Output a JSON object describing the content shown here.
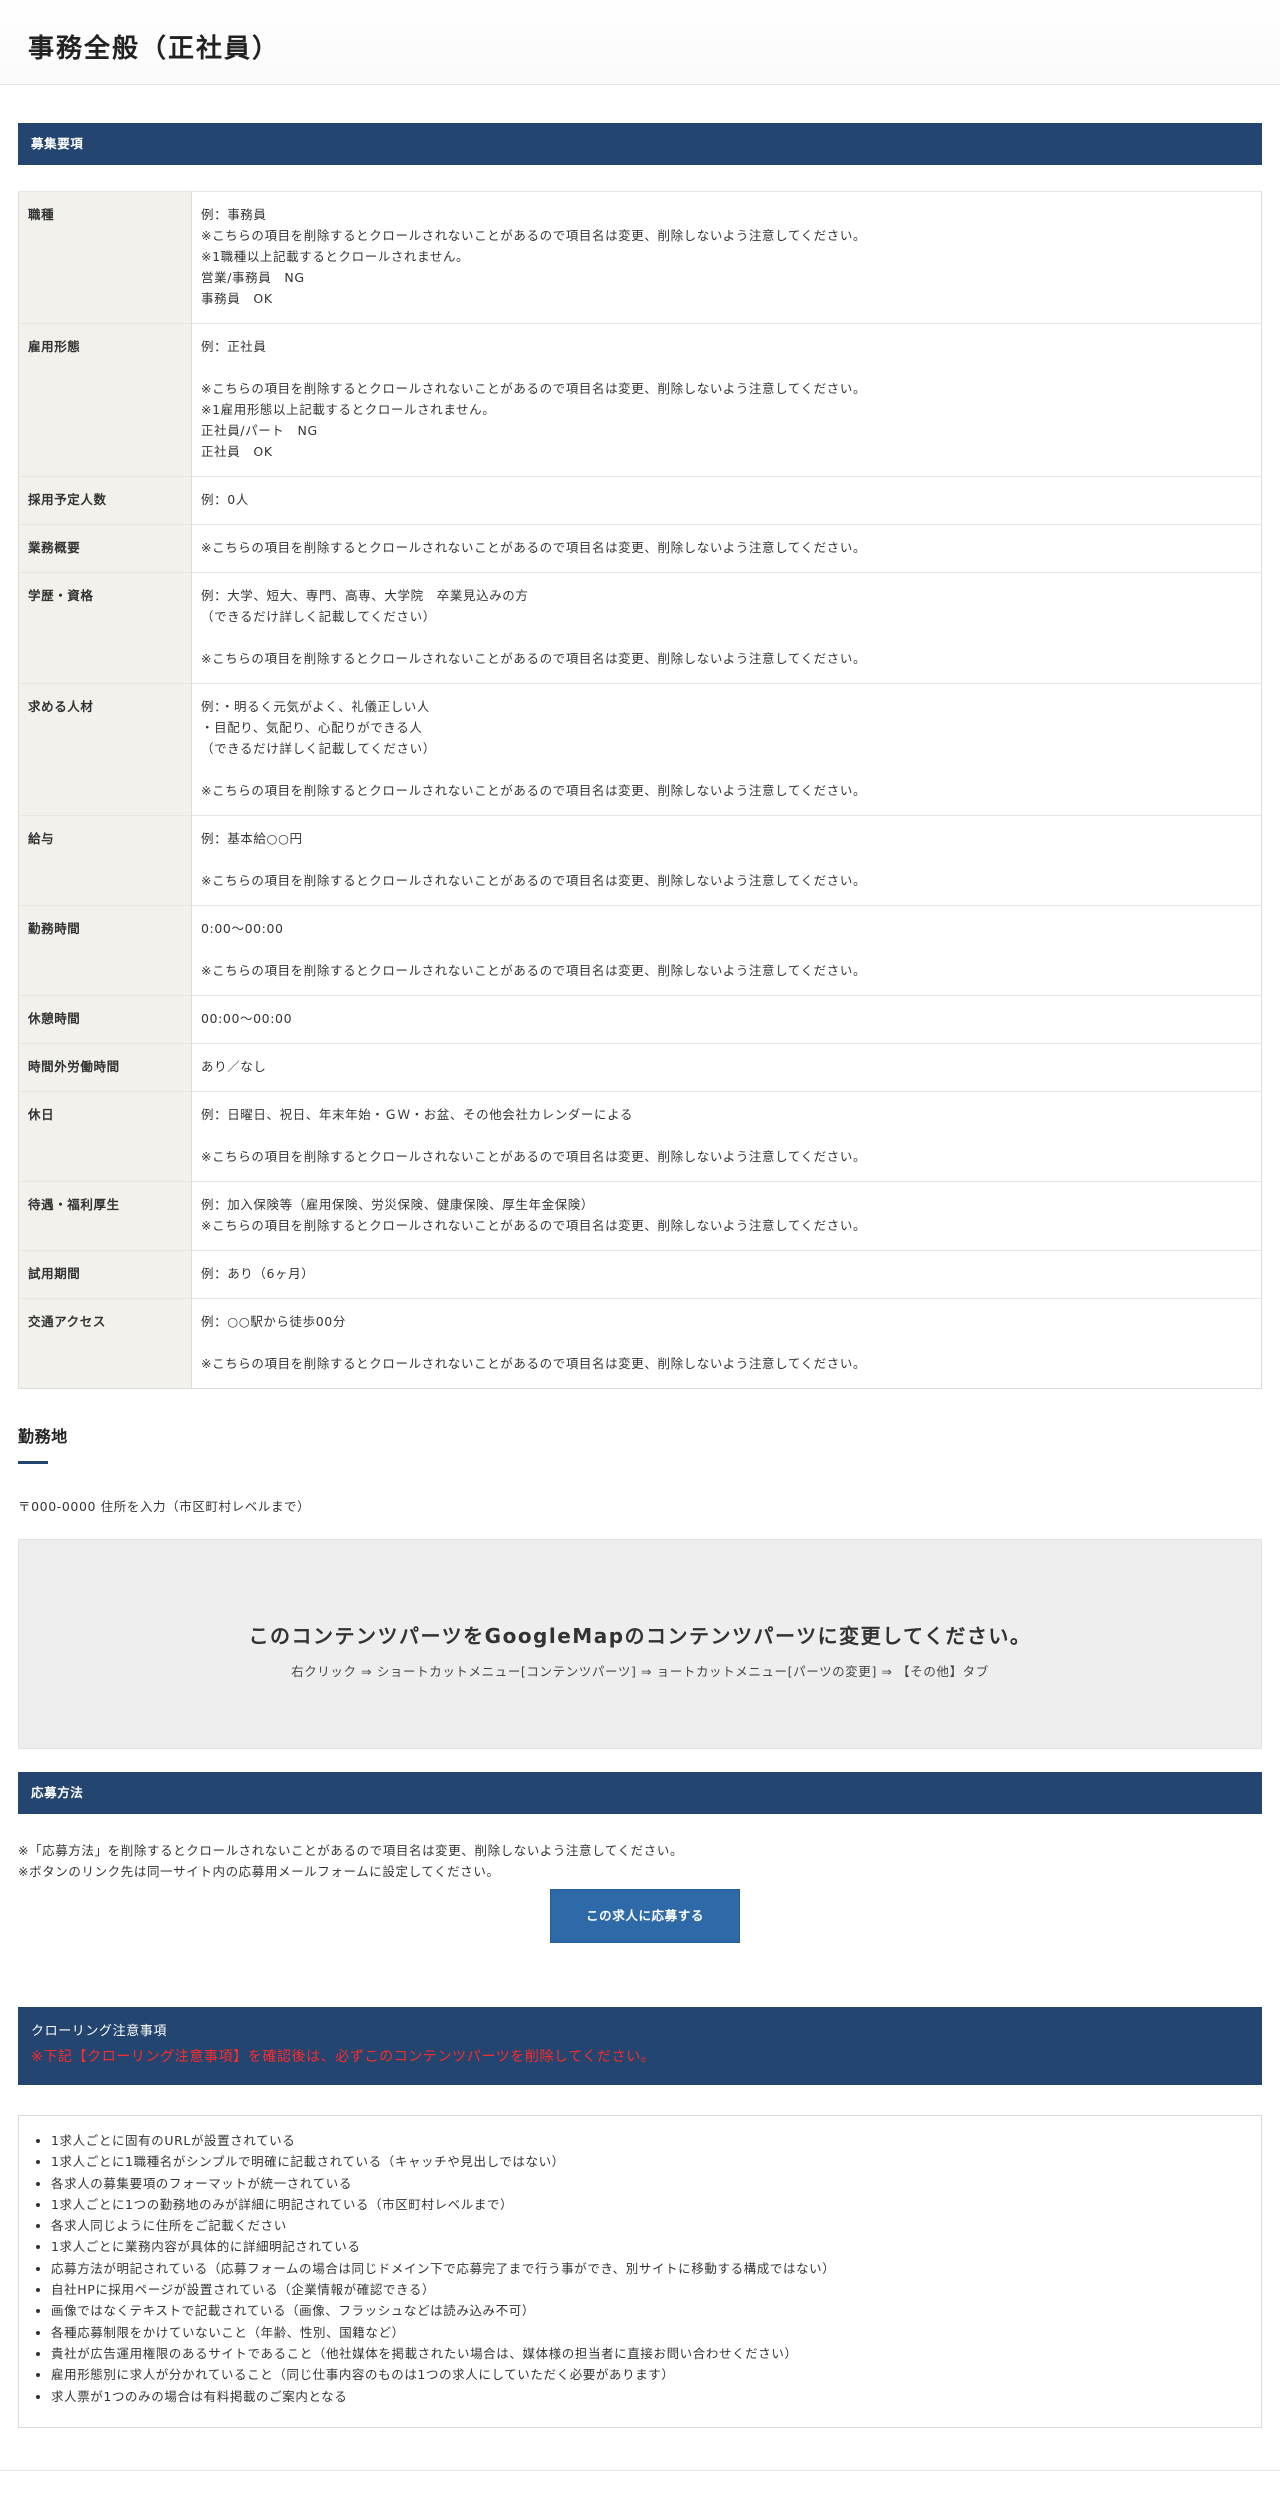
{
  "page_title": "事務全般（正社員）",
  "sections": {
    "boshu": "募集要項",
    "kinmuchi": "勤務地",
    "oubo": "応募方法",
    "crawl_title": "クローリング注意事項",
    "crawl_warning": "※下記【クローリング注意事項】を確認後は、必ずこのコンテンツパーツを削除してください。"
  },
  "requirements": [
    {
      "label": "職種",
      "lines": [
        "例：事務員",
        "※こちらの項目を削除するとクロールされないことがあるので項目名は変更、削除しないよう注意してください。",
        "※1職種以上記載するとクロールされません。",
        "営業/事務員　NG",
        "事務員　OK"
      ]
    },
    {
      "label": "雇用形態",
      "lines": [
        "例：正社員",
        "",
        "※こちらの項目を削除するとクロールされないことがあるので項目名は変更、削除しないよう注意してください。",
        "※1雇用形態以上記載するとクロールされません。",
        "正社員/パート　NG",
        "正社員　OK"
      ]
    },
    {
      "label": "採用予定人数",
      "lines": [
        "例：0人"
      ]
    },
    {
      "label": "業務概要",
      "lines": [
        "※こちらの項目を削除するとクロールされないことがあるので項目名は変更、削除しないよう注意してください。"
      ]
    },
    {
      "label": "学歴・資格",
      "lines": [
        "例：大学、短大、専門、高専、大学院　卒業見込みの方",
        "（できるだけ詳しく記載してください）",
        "",
        "※こちらの項目を削除するとクロールされないことがあるので項目名は変更、削除しないよう注意してください。"
      ]
    },
    {
      "label": "求める人材",
      "lines": [
        "例：・明るく元気がよく、礼儀正しい人",
        "・目配り、気配り、心配りができる人",
        "（できるだけ詳しく記載してください）",
        "",
        "※こちらの項目を削除するとクロールされないことがあるので項目名は変更、削除しないよう注意してください。"
      ]
    },
    {
      "label": "給与",
      "lines": [
        "例：基本給○○円",
        "",
        "※こちらの項目を削除するとクロールされないことがあるので項目名は変更、削除しないよう注意してください。"
      ]
    },
    {
      "label": "勤務時間",
      "lines": [
        "0:00〜00:00",
        "",
        "※こちらの項目を削除するとクロールされないことがあるので項目名は変更、削除しないよう注意してください。"
      ]
    },
    {
      "label": "休憩時間",
      "lines": [
        "00:00〜00:00"
      ]
    },
    {
      "label": "時間外労働時間",
      "lines": [
        "あり／なし"
      ]
    },
    {
      "label": "休日",
      "lines": [
        "例：日曜日、祝日、年末年始・ＧＷ・お盆、その他会社カレンダーによる",
        "",
        "※こちらの項目を削除するとクロールされないことがあるので項目名は変更、削除しないよう注意してください。"
      ]
    },
    {
      "label": "待遇・福利厚生",
      "lines": [
        "例：加入保険等（雇用保険、労災保険、健康保険、厚生年金保険）",
        "※こちらの項目を削除するとクロールされないことがあるので項目名は変更、削除しないよう注意してください。"
      ]
    },
    {
      "label": "試用期間",
      "lines": [
        "例：あり（6ヶ月）"
      ]
    },
    {
      "label": "交通アクセス",
      "lines": [
        "例：○○駅から徒歩00分",
        "",
        "※こちらの項目を削除するとクロールされないことがあるので項目名は変更、削除しないよう注意してください。"
      ]
    }
  ],
  "address": "〒000-0000 住所を入力（市区町村レベルまで）",
  "map": {
    "main": "このコンテンツパーツをGoogleMapのコンテンツパーツに変更してください。",
    "sub": "右クリック ⇒ ショートカットメニュー[コンテンツパーツ] ⇒ ョートカットメニュー[パーツの変更] ⇒ 【その他】タブ"
  },
  "apply_notes": [
    "※「応募方法」を削除するとクロールされないことがあるので項目名は変更、削除しないよう注意してください。",
    "※ボタンのリンク先は同一サイト内の応募用メールフォームに設定してください。"
  ],
  "apply_button": "この求人に応募する",
  "checklist": [
    "1求人ごとに固有のURLが設置されている",
    "1求人ごとに1職種名がシンプルで明確に記載されている（キャッチや見出しではない）",
    "各求人の募集要項のフォーマットが統一されている",
    "1求人ごとに1つの勤務地のみが詳細に明記されている（市区町村レベルまで）",
    "各求人同じように住所をご記載ください",
    "1求人ごとに業務内容が具体的に詳細明記されている",
    "応募方法が明記されている（応募フォームの場合は同じドメイン下で応募完了まで行う事ができ、別サイトに移動する構成ではない）",
    "自社HPに採用ページが設置されている（企業情報が確認できる）",
    "画像ではなくテキストで記載されている（画像、フラッシュなどは読み込み不可）",
    "各種応募制限をかけていないこと（年齢、性別、国籍など）",
    "貴社が広告運用権限のあるサイトであること（他社媒体を掲載されたい場合は、媒体様の担当者に直接お問い合わせください）",
    "雇用形態別に求人が分かれていること（同じ仕事内容のものは1つの求人にしていただく必要があります）",
    "求人票が1つのみの場合は有料掲載のご案内となる"
  ]
}
